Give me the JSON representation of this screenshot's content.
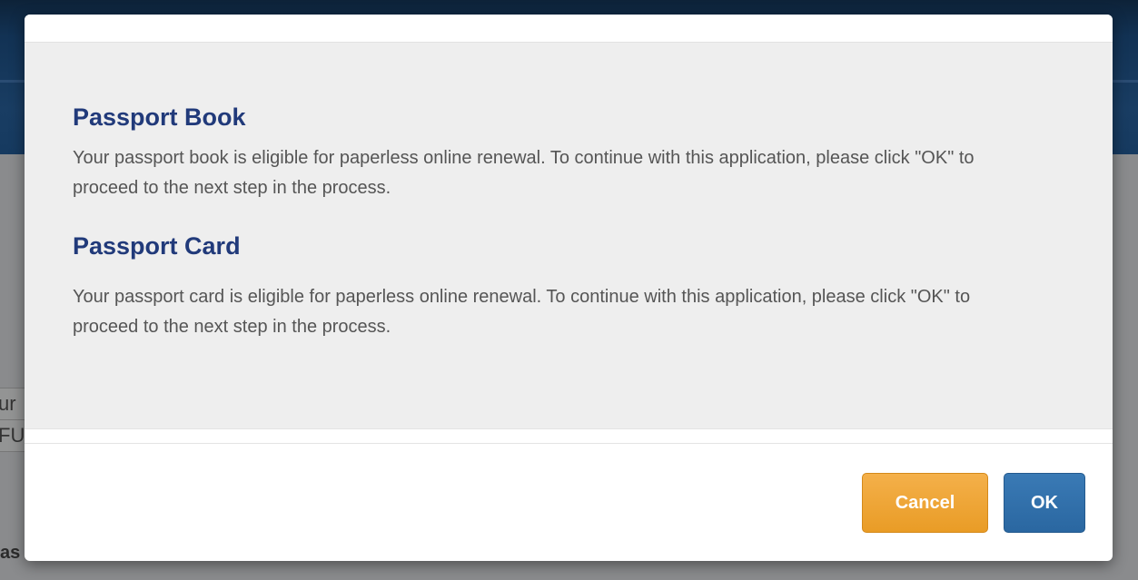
{
  "background": {
    "field_1_text": "ur",
    "field_2_text": "FU",
    "label_text": "as"
  },
  "modal": {
    "sections": [
      {
        "title": "Passport Book",
        "text": "Your passport book is eligible for paperless online renewal. To continue with this application, please click \"OK\" to proceed to the next step in the process."
      },
      {
        "title": "Passport Card",
        "text": "Your passport card is eligible for paperless online renewal. To continue with this application, please click \"OK\" to proceed to the next step in the process."
      }
    ],
    "buttons": {
      "cancel_label": "Cancel",
      "ok_label": "OK"
    }
  },
  "colors": {
    "title": "#213a7a",
    "body_text": "#555555",
    "cancel_button": "#eda232",
    "ok_button": "#3070aa",
    "header_bg": "#163a60"
  }
}
